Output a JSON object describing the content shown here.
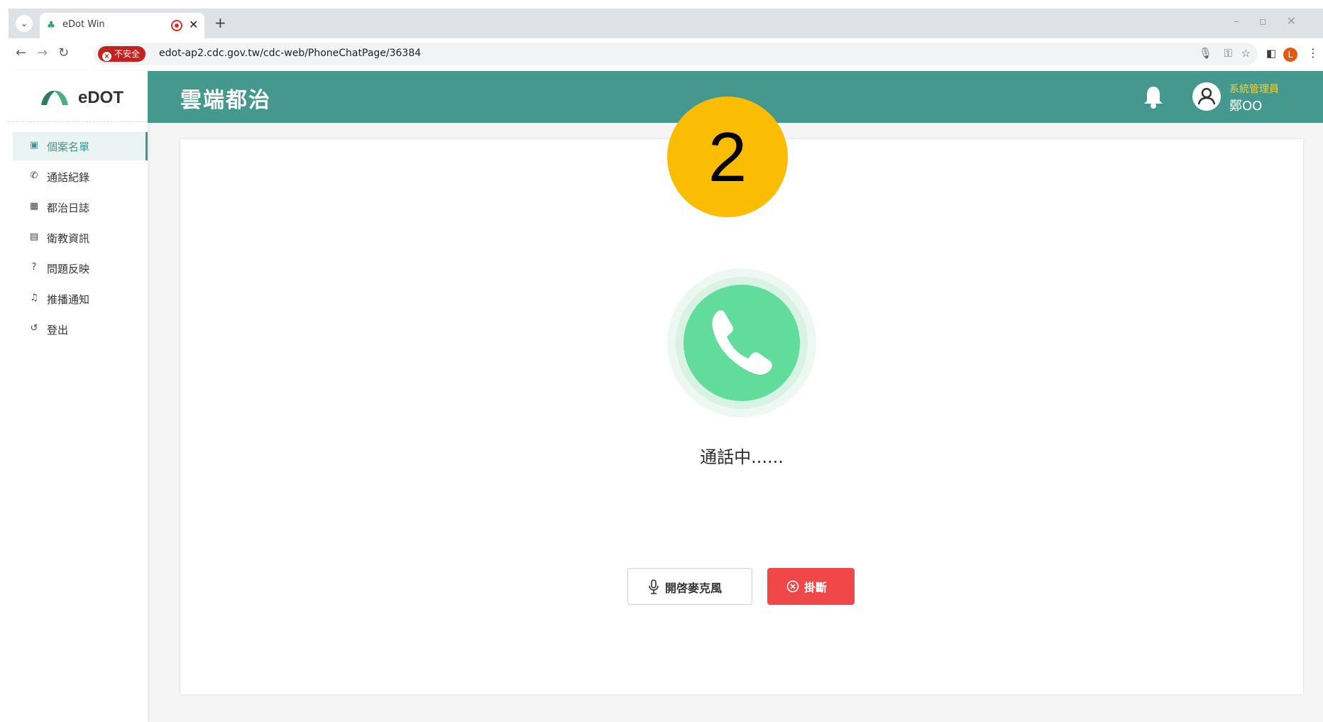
{
  "browser": {
    "tab_title": "eDot Win",
    "url": "edot-ap2.cdc.gov.tw/cdc-web/PhoneChatPage/36384",
    "security_label": "不安全",
    "profile_initial": "L"
  },
  "sidebar": {
    "brand": "eDOT",
    "items": [
      {
        "label": "個案名單",
        "icon": "id-card-icon",
        "glyph": "▣",
        "active": true
      },
      {
        "label": "通話紀錄",
        "icon": "phone-icon",
        "glyph": "✆",
        "active": false
      },
      {
        "label": "都治日誌",
        "icon": "grid-icon",
        "glyph": "▦",
        "active": false
      },
      {
        "label": "衛教資訊",
        "icon": "document-icon",
        "glyph": "▤",
        "active": false
      },
      {
        "label": "問題反映",
        "icon": "question-icon",
        "glyph": "?",
        "active": false
      },
      {
        "label": "推播通知",
        "icon": "bell-icon",
        "glyph": "♫",
        "active": false
      },
      {
        "label": "登出",
        "icon": "logout-icon",
        "glyph": "↺",
        "active": false
      }
    ]
  },
  "header": {
    "title": "雲端都治",
    "user_role": "系統管理員",
    "user_name": "鄭OO"
  },
  "main": {
    "step_badge": "2",
    "call_status": "通話中......",
    "mic_button_label": "開啓麥克風",
    "hangup_button_label": "掛斷"
  },
  "colors": {
    "header": "#45988e",
    "accent": "#3d9a8d",
    "call_green": "#62dc9a",
    "hangup_red": "#f04848",
    "badge_yellow": "#fbbc04",
    "role_yellow": "#f2d33a"
  }
}
